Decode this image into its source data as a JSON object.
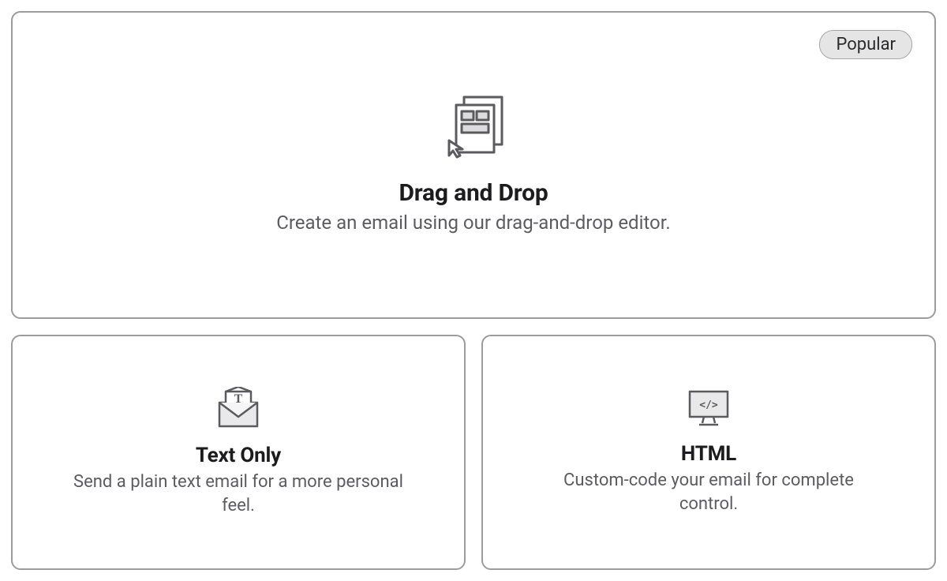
{
  "cards": {
    "dragdrop": {
      "badge": "Popular",
      "title": "Drag and Drop",
      "subtitle": "Create an email using our drag-and-drop editor."
    },
    "textonly": {
      "title": "Text Only",
      "subtitle": "Send a plain text email for a more personal feel."
    },
    "html": {
      "title": "HTML",
      "subtitle": "Custom-code your email for complete control."
    }
  }
}
